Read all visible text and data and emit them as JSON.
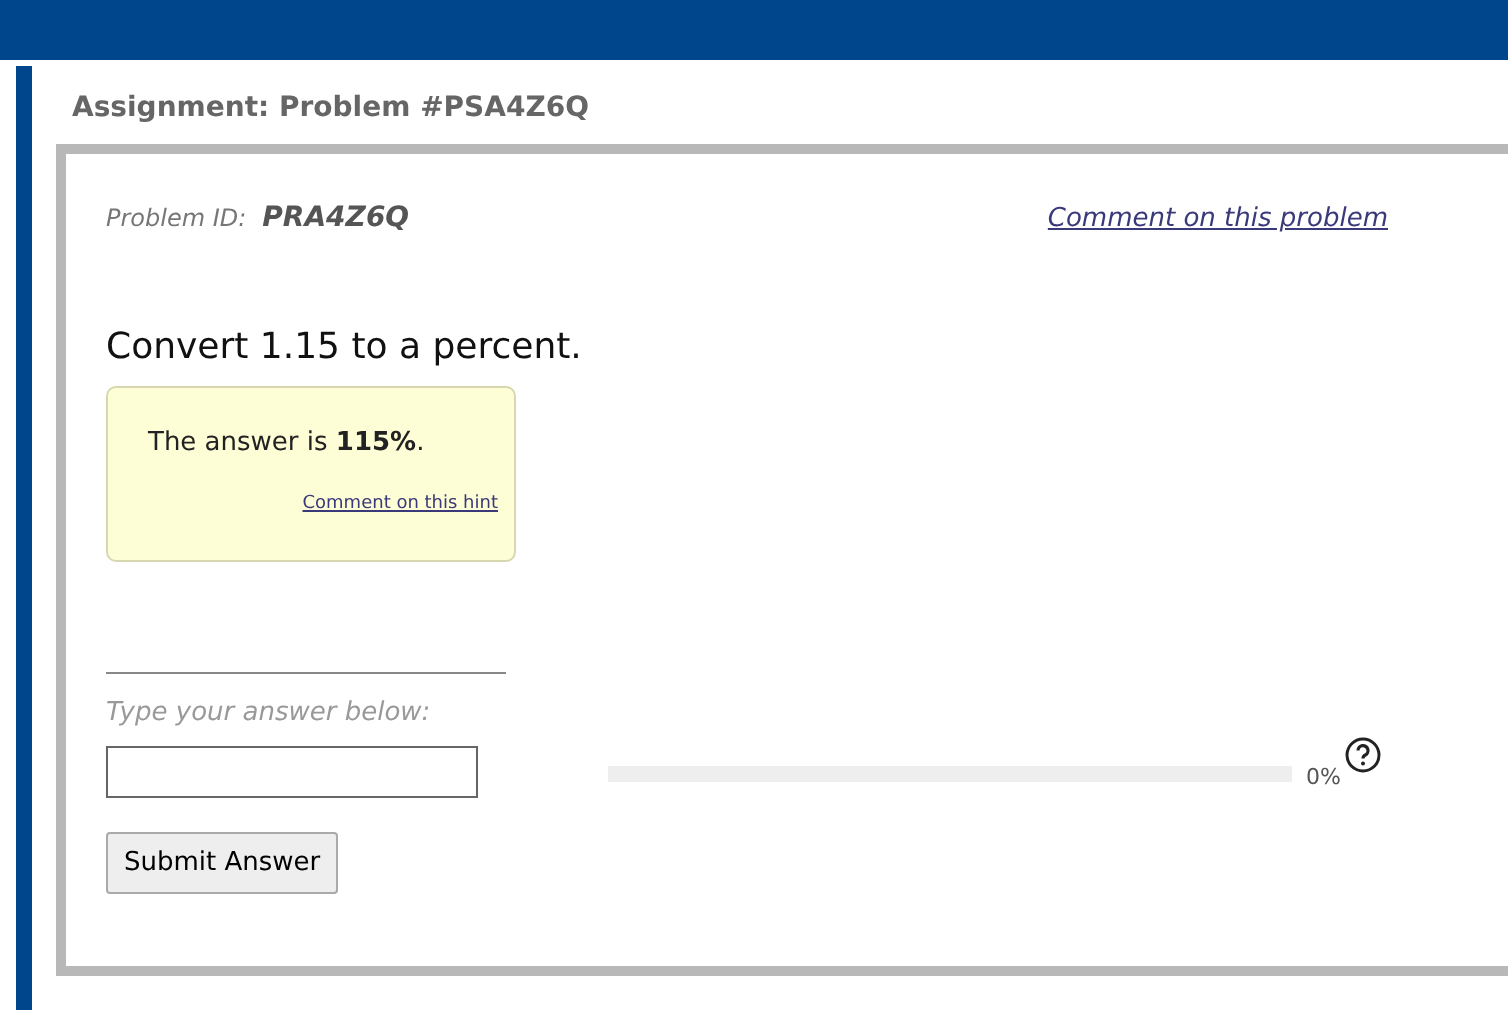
{
  "heading": "Assignment: Problem #PSA4Z6Q",
  "problem": {
    "id_label": "Problem ID:",
    "id": "PRA4Z6Q",
    "comment_link": "Comment on this problem"
  },
  "question": "Convert 1.15 to a percent.",
  "hint": {
    "text": "The answer is **115%**.",
    "comment_link": "Comment on this hint"
  },
  "answer": {
    "label": "Type your answer below:"
  },
  "submit": "Submit Answer",
  "progress": {
    "level": 0,
    "reading": "0%"
  }
}
